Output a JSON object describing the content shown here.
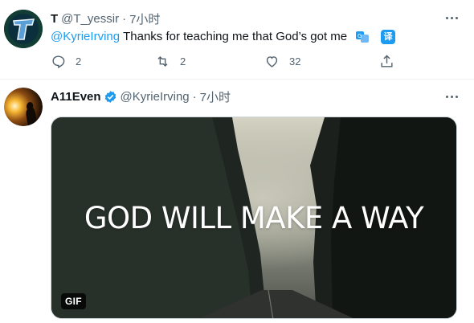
{
  "tweet1": {
    "display_name": "T",
    "handle": "@T_yessir",
    "separator": "·",
    "time": "7小时",
    "mention": "@KyrieIrving",
    "text": "Thanks for teaching me that God’s got me",
    "translate_label": "译",
    "reply_count": "2",
    "retweet_count": "2",
    "like_count": "32"
  },
  "tweet2": {
    "display_name": "A11Even",
    "handle": "@KyrieIrving",
    "separator": "·",
    "time": "7小时",
    "media": {
      "caption": "GOD WILL MAKE A WAY",
      "badge": "GIF"
    }
  },
  "colors": {
    "accent": "#1d9bf0",
    "secondary_text": "#536471",
    "divider": "#eff3f4"
  },
  "icons": [
    "more-icon",
    "reply-icon",
    "retweet-icon",
    "like-icon",
    "share-icon",
    "verified-icon",
    "translate-icon"
  ]
}
